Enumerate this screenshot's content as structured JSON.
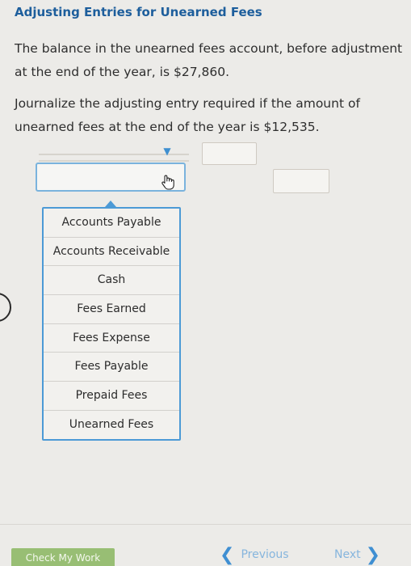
{
  "page": {
    "title": "Adjusting Entries for Unearned Fees",
    "paragraph1": "The balance in the unearned fees account, before adjustment at the end of the year, is $27,860.",
    "paragraph2": "Journalize the adjusting entry required if the amount of unearned fees at the end of the year is $12,535."
  },
  "journal": {
    "row1_dropdown_arrow": "▼",
    "debit_value": "",
    "credit_value": "",
    "selected_account": ""
  },
  "dropdown": {
    "options": [
      "Accounts Payable",
      "Accounts Receivable",
      "Cash",
      "Fees Earned",
      "Fees Expense",
      "Fees Payable",
      "Prepaid Fees",
      "Unearned Fees"
    ]
  },
  "footer": {
    "check_label": "Check My Work",
    "previous_label": "Previous",
    "next_label": "Next",
    "previous_chevron": "❮",
    "next_chevron": "❯"
  },
  "colors": {
    "title": "#1d5e9c",
    "accent": "#4c9ad6",
    "check_button": "#98be74"
  }
}
